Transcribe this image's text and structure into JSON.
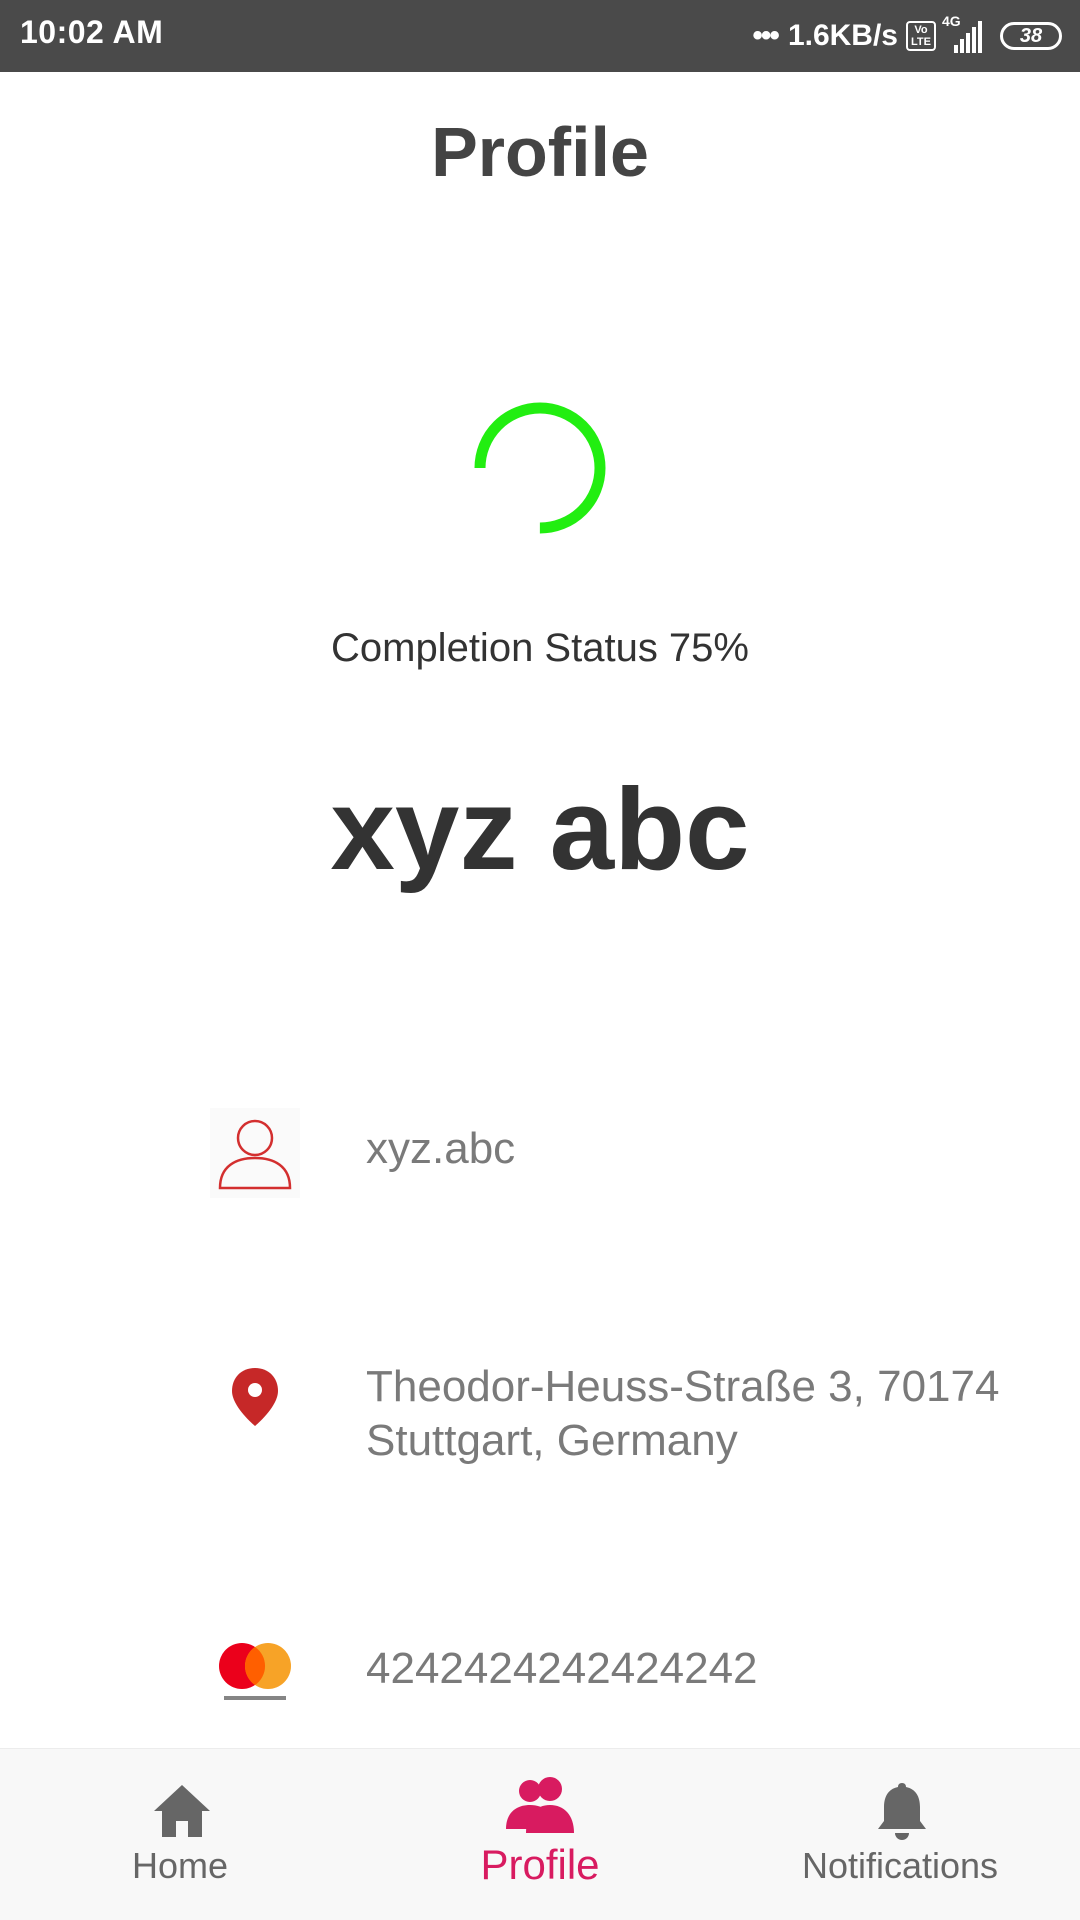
{
  "status_bar": {
    "time": "10:02 AM",
    "dots": "•••",
    "speed": "1.6KB/s",
    "volte_top": "Vo",
    "volte_bottom": "LTE",
    "network": "4G",
    "battery": "38"
  },
  "header": {
    "title": "Profile"
  },
  "progress": {
    "percent": 75,
    "color": "#22ee11",
    "label": "Completion Status 75%"
  },
  "user": {
    "full_name": "xyz abc",
    "username": "xyz.abc",
    "address": "Theodor-Heuss-Straße 3, 70174 Stuttgart, Germany",
    "card_number": "4242424242424242"
  },
  "icons": {
    "user": "person-outline-icon",
    "location": "location-pin-icon",
    "card": "mastercard-icon"
  },
  "colors": {
    "accent": "#d81b60",
    "icon_red": "#c62828",
    "nav_inactive": "#666666"
  },
  "bottom_nav": {
    "items": [
      {
        "label": "Home",
        "icon": "home-icon",
        "active": false
      },
      {
        "label": "Profile",
        "icon": "people-icon",
        "active": true
      },
      {
        "label": "Notifications",
        "icon": "bell-icon",
        "active": false
      }
    ]
  }
}
